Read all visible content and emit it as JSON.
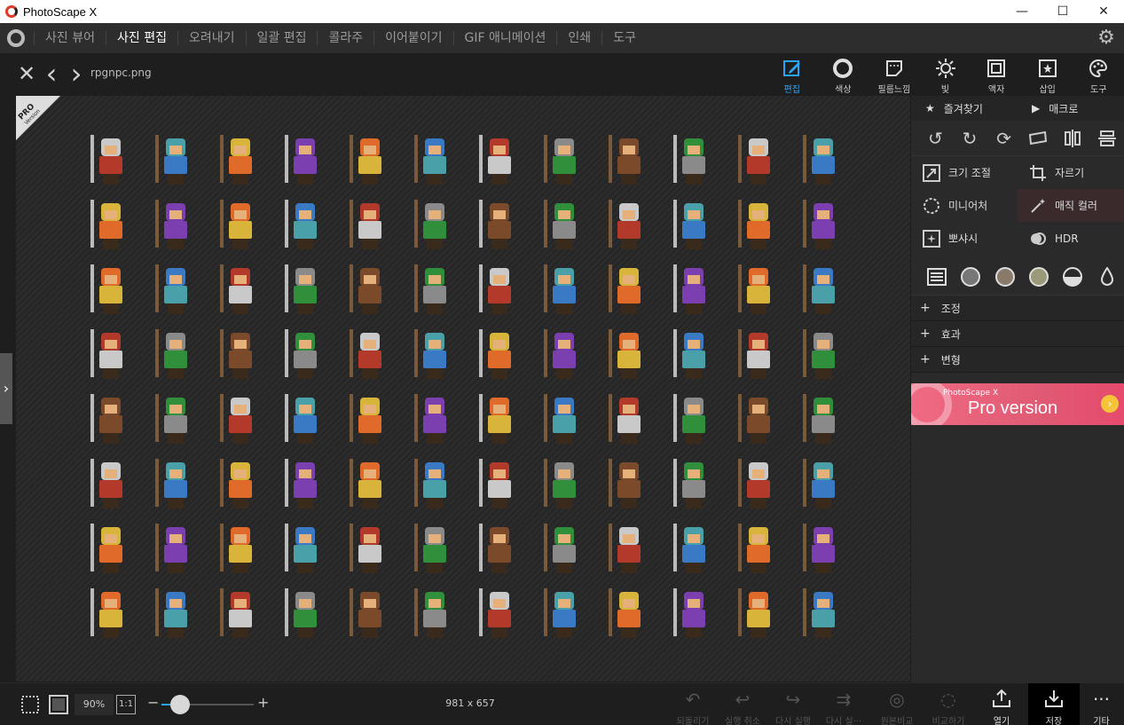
{
  "window": {
    "title": "PhotoScape X",
    "minimize": "—",
    "maximize": "☐",
    "close": "✕"
  },
  "menu": {
    "items": [
      "사진 뷰어",
      "사진 편집",
      "오려내기",
      "일괄 편집",
      "콜라주",
      "이어붙이기",
      "GIF 애니메이션",
      "인쇄",
      "도구"
    ],
    "active_index": 1
  },
  "canvas_header": {
    "close": "✕",
    "prev": "‹",
    "next": "›",
    "filename": "rpgnpc.png"
  },
  "tool_tabs": [
    {
      "label": "편집",
      "icon": "edit-icon",
      "active": true
    },
    {
      "label": "색상",
      "icon": "color-circle-icon",
      "active": false
    },
    {
      "label": "필름느낌",
      "icon": "film-icon",
      "active": false
    },
    {
      "label": "빛",
      "icon": "sun-icon",
      "active": false
    },
    {
      "label": "액자",
      "icon": "frame-icon",
      "active": false
    },
    {
      "label": "삽입",
      "icon": "insert-star-icon",
      "active": false
    },
    {
      "label": "도구",
      "icon": "palette-icon",
      "active": false
    }
  ],
  "pro_badge": {
    "line1": "PRO",
    "line2": "Version"
  },
  "right_panel": {
    "favorites": "즐겨찾기",
    "macro": "매크로",
    "rotate_icons": [
      "rotate-left-icon",
      "rotate-right-icon",
      "rotate-free-icon",
      "straighten-icon",
      "flip-horizontal-icon",
      "flip-vertical-icon"
    ],
    "tools": [
      {
        "label": "크기 조절",
        "icon": "resize-icon",
        "highlight": false
      },
      {
        "label": "자르기",
        "icon": "crop-icon",
        "highlight": false
      },
      {
        "label": "미니어처",
        "icon": "miniature-icon",
        "highlight": false
      },
      {
        "label": "매직 컬러",
        "icon": "magic-wand-icon",
        "highlight": true
      },
      {
        "label": "뽀샤시",
        "icon": "bloom-icon",
        "highlight": false
      },
      {
        "label": "HDR",
        "icon": "hdr-icon",
        "highlight": false
      }
    ],
    "filters": [
      "list-icon",
      "filter-gray-icon",
      "filter-sepia-icon",
      "filter-warm-icon",
      "filter-half-icon",
      "drop-icon"
    ],
    "sections": [
      "조정",
      "효과",
      "변형"
    ],
    "banner": {
      "small": "PhotoScape X",
      "big": "Pro version",
      "go": "›"
    }
  },
  "bottom": {
    "zoom": "90%",
    "actual_size": "1:1",
    "minus": "−",
    "plus": "+",
    "zoom_slider_value": 0.2,
    "dimensions": "981 x 657",
    "actions": [
      {
        "label": "되돌리기",
        "icon": "revert-icon",
        "enabled": false
      },
      {
        "label": "실행 취소",
        "icon": "undo-icon",
        "enabled": false
      },
      {
        "label": "다시 실행",
        "icon": "redo-icon",
        "enabled": false
      },
      {
        "label": "다시 실···",
        "icon": "redo-all-icon",
        "enabled": false
      },
      {
        "label": "원본비교",
        "icon": "compare-original-icon",
        "enabled": false
      },
      {
        "label": "비교하기",
        "icon": "compare-icon",
        "enabled": false
      },
      {
        "label": "열기",
        "icon": "open-icon",
        "enabled": true
      },
      {
        "label": "저장",
        "icon": "save-icon",
        "enabled": true
      },
      {
        "label": "기타",
        "icon": "more-icon",
        "enabled": true
      }
    ]
  },
  "sprite_sheet": {
    "rows": 8,
    "cols": 12,
    "palette": [
      "#c9c9c9",
      "#7b3fb0",
      "#b33a2a",
      "#2f8f3a",
      "#d8b43a",
      "#3a7ac4",
      "#7a4a2a",
      "#4aa0a8",
      "#e06a2a",
      "#8a8a8a"
    ]
  }
}
